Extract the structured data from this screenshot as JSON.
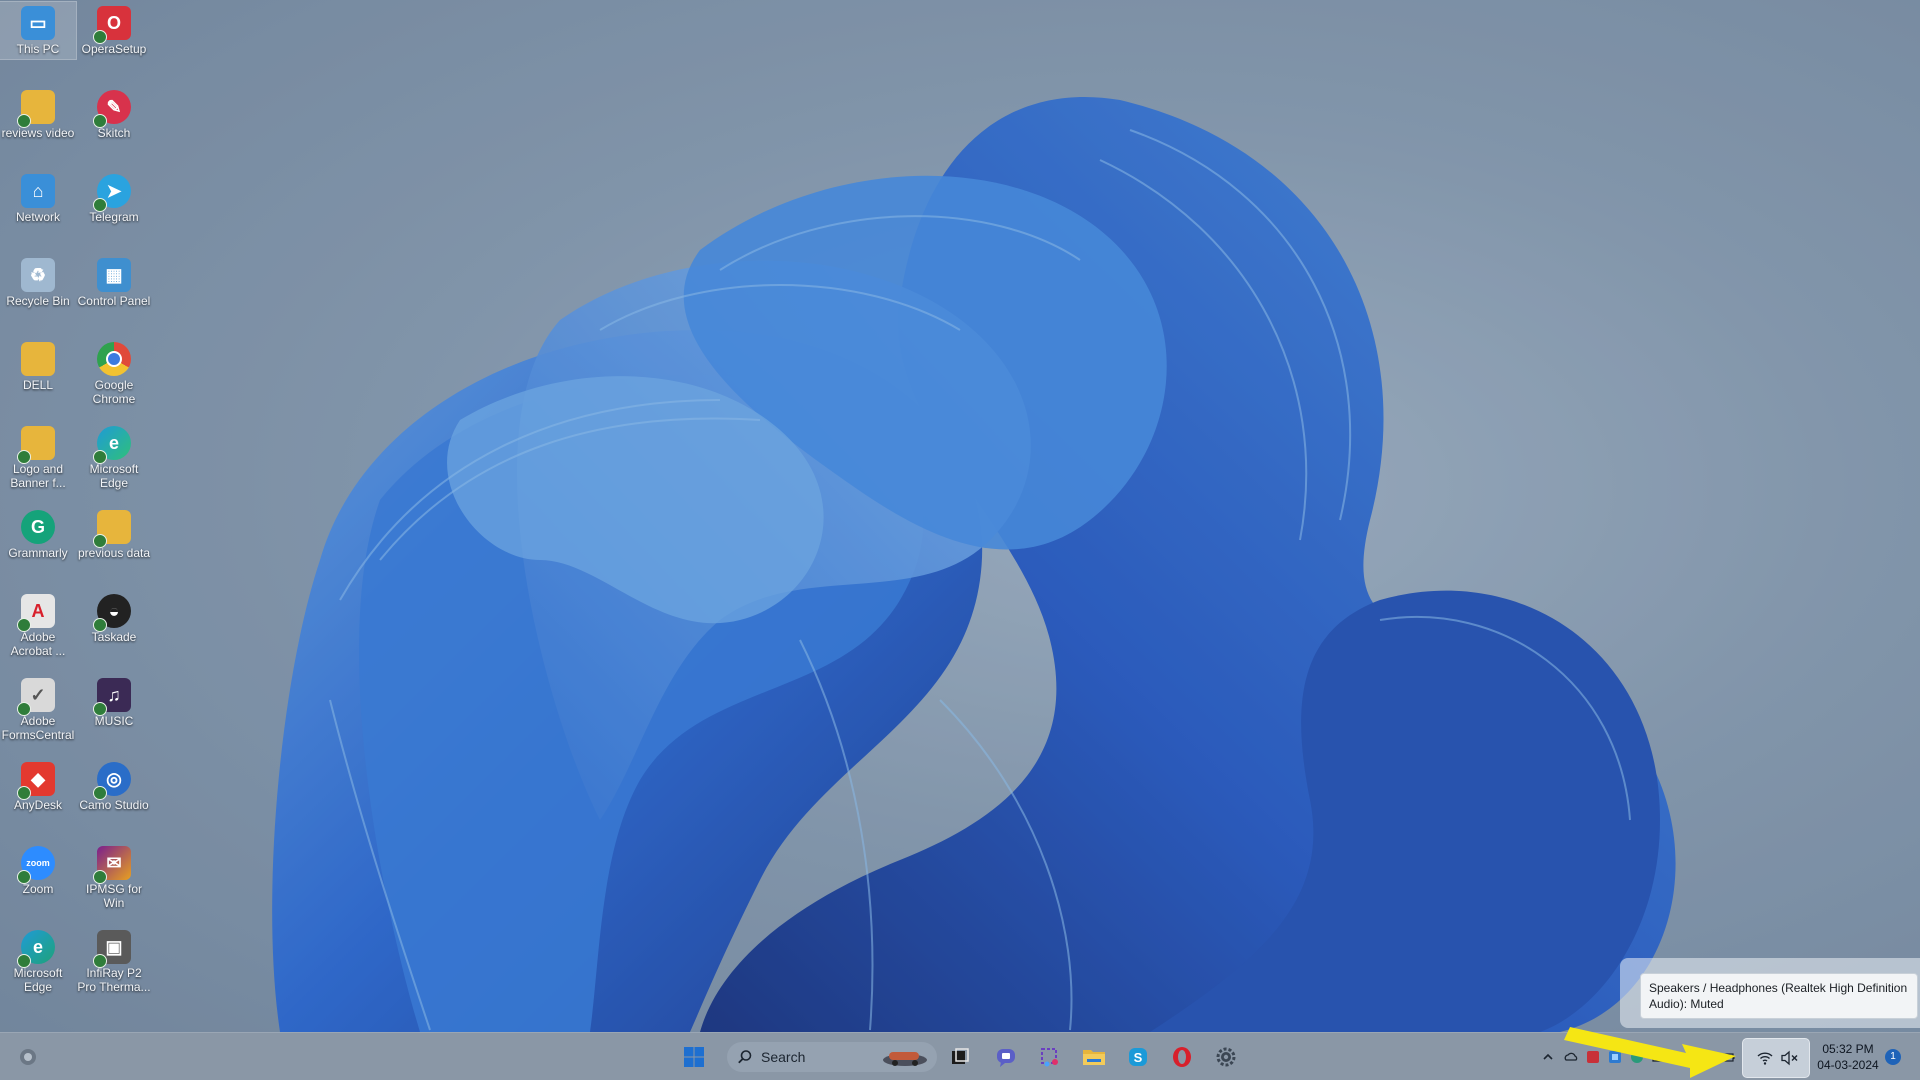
{
  "desktop": {
    "icons": [
      {
        "label": "This PC",
        "icon": "monitor-icon",
        "color": "#3a8fd8"
      },
      {
        "label": "OperaSetup",
        "icon": "opera-setup-icon",
        "color": "#d8323c"
      },
      {
        "label": "reviews video",
        "icon": "folder-icon",
        "color": "#e7b53c"
      },
      {
        "label": "Skitch",
        "icon": "skitch-icon",
        "color": "#d8324c"
      },
      {
        "label": "Network",
        "icon": "network-icon",
        "color": "#3a8fd8"
      },
      {
        "label": "Telegram",
        "icon": "telegram-icon",
        "color": "#2aa3df"
      },
      {
        "label": "Recycle Bin",
        "icon": "recycle-bin-icon",
        "color": "#9fb8d0"
      },
      {
        "label": "Control Panel",
        "icon": "control-panel-icon",
        "color": "#3f8fcf"
      },
      {
        "label": "DELL",
        "icon": "folder-icon",
        "color": "#e7b53c"
      },
      {
        "label": "Google Chrome",
        "icon": "chrome-icon",
        "color": "#e04a3a"
      },
      {
        "label": "Logo and Banner f...",
        "icon": "folder-icon",
        "color": "#e7b53c"
      },
      {
        "label": "Microsoft Edge",
        "icon": "edge-icon",
        "color": "#1f9bd6"
      },
      {
        "label": "Grammarly",
        "icon": "grammarly-icon",
        "color": "#15a37a"
      },
      {
        "label": "previous data",
        "icon": "folder-icon",
        "color": "#e7b53c"
      },
      {
        "label": "Adobe Acrobat ...",
        "icon": "acrobat-icon",
        "color": "#e6e6e6"
      },
      {
        "label": "Taskade",
        "icon": "taskade-icon",
        "color": "#222222"
      },
      {
        "label": "Adobe FormsCentral",
        "icon": "forms-central-icon",
        "color": "#d9d9d9"
      },
      {
        "label": "MUSIC",
        "icon": "music-icon",
        "color": "#3b2a55"
      },
      {
        "label": "AnyDesk",
        "icon": "anydesk-icon",
        "color": "#e3392f"
      },
      {
        "label": "Camo Studio",
        "icon": "camo-studio-icon",
        "color": "#2a6dc8"
      },
      {
        "label": "Zoom",
        "icon": "zoom-icon",
        "color": "#2d8cff"
      },
      {
        "label": "IPMSG for Win",
        "icon": "ipmsg-icon",
        "color": "#7a1e8e"
      },
      {
        "label": "Microsoft Edge",
        "icon": "edge-icon",
        "color": "#1fa27a"
      },
      {
        "label": "InfiRay P2 Pro Therma...",
        "icon": "infiray-icon",
        "color": "#5a5a5a"
      }
    ]
  },
  "taskbar": {
    "search_placeholder": "Search",
    "apps": [
      {
        "name": "start-button",
        "icon": "windows-logo-icon",
        "color": "#1e6fd0"
      },
      {
        "name": "task-view-button",
        "icon": "task-view-icon",
        "color": "#1c1c1c"
      },
      {
        "name": "teams-button",
        "icon": "teams-chat-icon",
        "color": "#5b5fc7"
      },
      {
        "name": "snipping-tool-button",
        "icon": "snipping-tool-icon",
        "color": "#6a3fc0"
      },
      {
        "name": "file-explorer-button",
        "icon": "folder-icon",
        "color": "#e7b53c"
      },
      {
        "name": "skype-button",
        "icon": "skype-icon",
        "color": "#1b9ad8"
      },
      {
        "name": "opera-button",
        "icon": "opera-icon",
        "color": "#d8202c"
      },
      {
        "name": "settings-button",
        "icon": "gear-icon",
        "color": "#3b4653"
      }
    ],
    "tray": {
      "clock_time": "05:32 PM",
      "clock_date": "04-03-2024",
      "notification_count": "1"
    }
  },
  "tooltip": {
    "text": "Speakers / Headphones (Realtek High Definition Audio): Muted"
  },
  "colors": {
    "accent_blue": "#1f5fd0",
    "annotation_yellow": "#f5e614",
    "taskbar": "#8a97a6"
  }
}
